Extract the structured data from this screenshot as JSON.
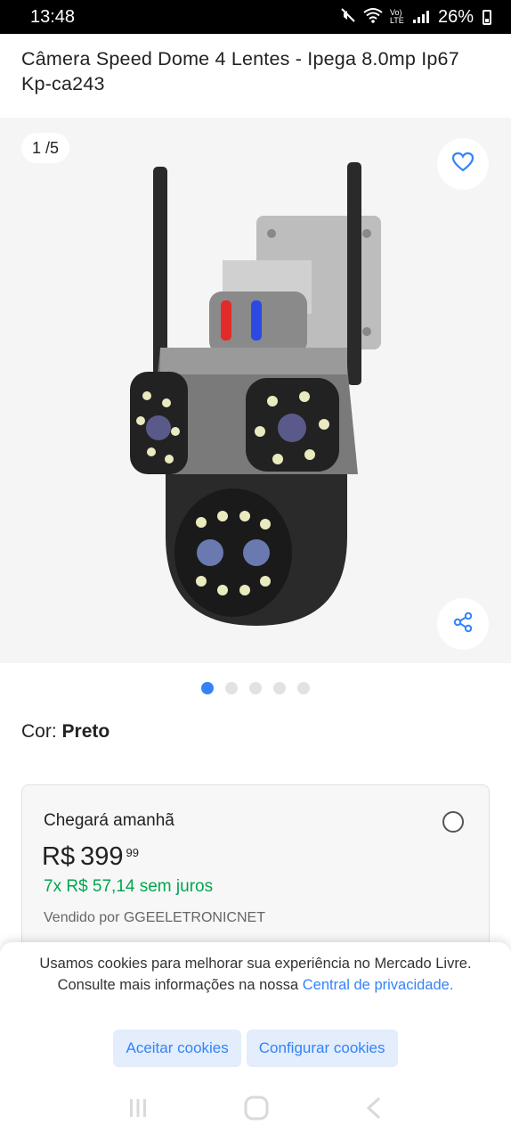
{
  "status_bar": {
    "time": "13:48",
    "battery": "26%",
    "network": "Vo) LTE"
  },
  "product": {
    "title": "Câmera Speed Dome 4 Lentes - Ipega 8.0mp Ip67 Kp-ca243"
  },
  "gallery": {
    "counter": "1 /5",
    "total_images": 5,
    "active_index": 0
  },
  "variant": {
    "label": "Cor:",
    "value": "Preto"
  },
  "offer": {
    "delivery": "Chegará amanhã",
    "currency": "R$",
    "price_int": "399",
    "price_cents": "99",
    "installments": "7x R$ 57,14 sem juros",
    "seller": "Vendido por GGEELETRONICNET"
  },
  "cookies": {
    "text": "Usamos cookies para melhorar sua experiência no Mercado Livre. Consulte mais informações na nossa",
    "link": "Central de privacidade.",
    "accept": "Aceitar cookies",
    "configure": "Configurar cookies"
  },
  "colors": {
    "accent": "#3483fa",
    "green": "#00a650"
  },
  "icons": [
    "mute-icon",
    "wifi-icon",
    "signal-icon",
    "battery-icon",
    "heart-icon",
    "share-icon",
    "recents-icon",
    "home-icon",
    "back-icon"
  ]
}
